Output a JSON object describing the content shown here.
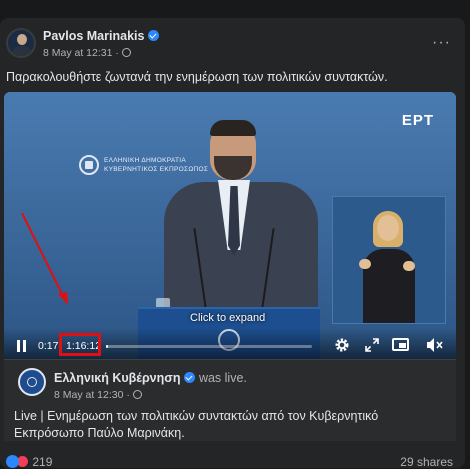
{
  "post": {
    "author": "Pavlos Marinakis",
    "date": "8 May at 12:31",
    "separator": "·",
    "text": "Παρακολουθήστε ζωντανά την ενημέρωση των πολιτικών συντακτών.",
    "more_label": "···"
  },
  "video": {
    "channel_logo": "ΕΡΤ",
    "gov_line1": "ΕΛΛΗΝΙΚΗ ΔΗΜΟΚΡΑΤΙΑ",
    "gov_line2": "ΚΥΒΕΡΝΗΤΙΚΟΣ ΕΚΠΡΟΣΩΠΟΣ",
    "overlay_text": "Click to expand",
    "current_time": "0:17",
    "duration": "1:16:12",
    "progress": 0.004
  },
  "shared": {
    "page_name": "Ελληνική Κυβέρνηση",
    "status": "was live.",
    "date": "8 May at 12:30",
    "separator": "·",
    "text": "Live | Ενημέρωση των πολιτικών συντακτών από τον Κυβερνητικό Εκπρόσωπο Παύλο Μαρινάκη."
  },
  "footer": {
    "reaction_count": "219",
    "shares": "29 shares"
  },
  "colors": {
    "background": "#242526",
    "accent": "#2d88ff",
    "highlight": "#e01010"
  }
}
